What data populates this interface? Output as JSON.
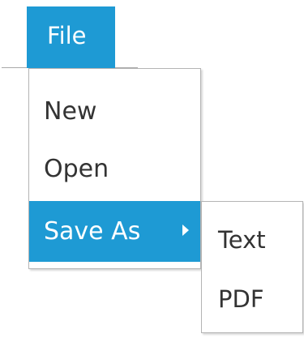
{
  "menubar": {
    "file_label": "File"
  },
  "file_menu": {
    "items": [
      {
        "label": "New"
      },
      {
        "label": "Open"
      },
      {
        "label": "Save As",
        "has_submenu": true,
        "highlighted": true
      }
    ]
  },
  "save_as_submenu": {
    "items": [
      {
        "label": "Text"
      },
      {
        "label": "PDF"
      }
    ]
  },
  "colors": {
    "accent": "#1e9ad4",
    "menu_text": "#333333",
    "border": "#b4b4b4"
  },
  "icons": {
    "submenu_arrow": "caret-right-icon"
  }
}
